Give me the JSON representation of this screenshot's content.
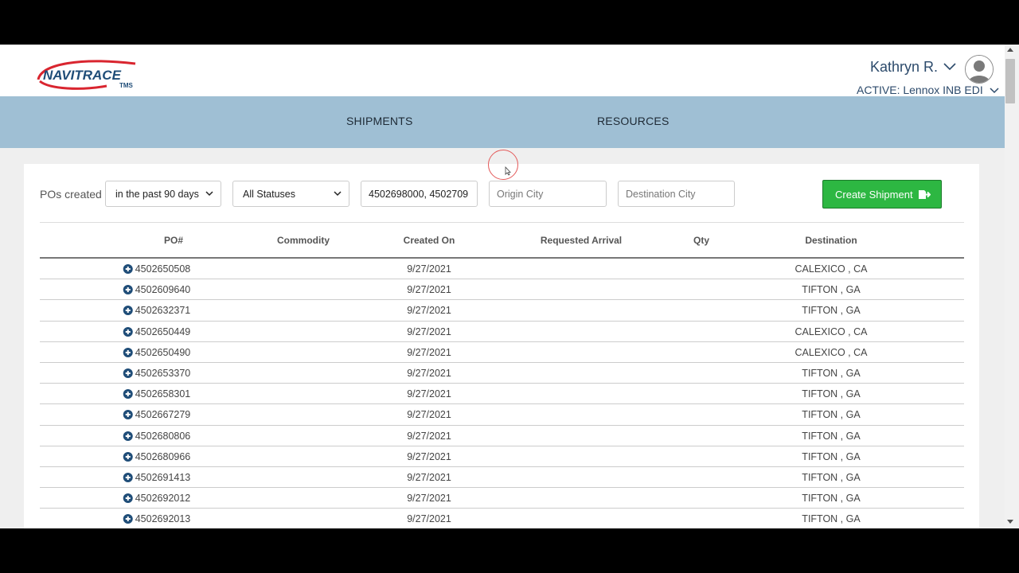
{
  "header": {
    "logo_text": "NAVITRACE",
    "logo_subtext": "TMS",
    "user_name": "Kathryn R.",
    "active_account": "ACTIVE: Lennox INB EDI"
  },
  "nav": {
    "items": [
      {
        "label": "SHIPMENTS"
      },
      {
        "label": "RESOURCES"
      }
    ]
  },
  "filters": {
    "label": "POs created",
    "date_range": "in the past 90 days",
    "status": "All Statuses",
    "po_search_value": "4502698000, 4502709",
    "origin_placeholder": "Origin City",
    "destination_placeholder": "Destination City",
    "create_button": "Create Shipment"
  },
  "table": {
    "columns": [
      "PO#",
      "Commodity",
      "Created On",
      "Requested Arrival",
      "Qty",
      "Destination"
    ],
    "rows": [
      {
        "po": "4502650508",
        "commodity": "",
        "created_on": "9/27/2021",
        "requested_arrival": "",
        "qty": "",
        "destination": "CALEXICO , CA"
      },
      {
        "po": "4502609640",
        "commodity": "",
        "created_on": "9/27/2021",
        "requested_arrival": "",
        "qty": "",
        "destination": "TIFTON , GA"
      },
      {
        "po": "4502632371",
        "commodity": "",
        "created_on": "9/27/2021",
        "requested_arrival": "",
        "qty": "",
        "destination": "TIFTON , GA"
      },
      {
        "po": "4502650449",
        "commodity": "",
        "created_on": "9/27/2021",
        "requested_arrival": "",
        "qty": "",
        "destination": "CALEXICO , CA"
      },
      {
        "po": "4502650490",
        "commodity": "",
        "created_on": "9/27/2021",
        "requested_arrival": "",
        "qty": "",
        "destination": "CALEXICO , CA"
      },
      {
        "po": "4502653370",
        "commodity": "",
        "created_on": "9/27/2021",
        "requested_arrival": "",
        "qty": "",
        "destination": "TIFTON , GA"
      },
      {
        "po": "4502658301",
        "commodity": "",
        "created_on": "9/27/2021",
        "requested_arrival": "",
        "qty": "",
        "destination": "TIFTON , GA"
      },
      {
        "po": "4502667279",
        "commodity": "",
        "created_on": "9/27/2021",
        "requested_arrival": "",
        "qty": "",
        "destination": "TIFTON , GA"
      },
      {
        "po": "4502680806",
        "commodity": "",
        "created_on": "9/27/2021",
        "requested_arrival": "",
        "qty": "",
        "destination": "TIFTON , GA"
      },
      {
        "po": "4502680966",
        "commodity": "",
        "created_on": "9/27/2021",
        "requested_arrival": "",
        "qty": "",
        "destination": "TIFTON , GA"
      },
      {
        "po": "4502691413",
        "commodity": "",
        "created_on": "9/27/2021",
        "requested_arrival": "",
        "qty": "",
        "destination": "TIFTON , GA"
      },
      {
        "po": "4502692012",
        "commodity": "",
        "created_on": "9/27/2021",
        "requested_arrival": "",
        "qty": "",
        "destination": "TIFTON , GA"
      },
      {
        "po": "4502692013",
        "commodity": "",
        "created_on": "9/27/2021",
        "requested_arrival": "",
        "qty": "",
        "destination": "TIFTON , GA"
      }
    ]
  },
  "colors": {
    "nav_bg": "#9fbfd4",
    "brand_blue": "#1f4d78",
    "brand_red": "#d9252f",
    "button_green": "#2db742"
  }
}
